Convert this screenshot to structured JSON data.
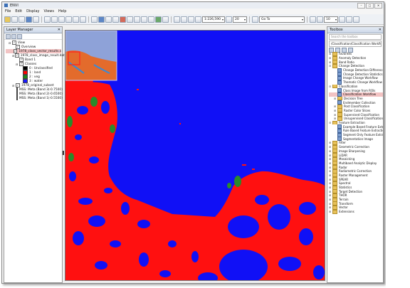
{
  "window": {
    "title": "ENVI"
  },
  "menu": [
    "File",
    "Edit",
    "Display",
    "Views",
    "Help"
  ],
  "toolbar": {
    "zoom_value": "1:226,590",
    "percent_value": "10",
    "goto_label": "Go To",
    "value2": "20"
  },
  "layer_manager": {
    "title": "Layer Manager",
    "items": [
      {
        "label": "View",
        "indent": 0
      },
      {
        "label": "Overview",
        "indent": 1
      },
      {
        "label": "1978_class_vector_results.s",
        "indent": 1,
        "highlight": "red"
      },
      {
        "label": "1978_class_image_result.dat",
        "indent": 1
      },
      {
        "label": "Band 1",
        "indent": 2
      },
      {
        "label": "Classes",
        "indent": 2
      },
      {
        "label": "0 : Unclassified",
        "indent": 3,
        "swatch": "#000000"
      },
      {
        "label": "1 : land",
        "indent": 3,
        "swatch": "#ff0000"
      },
      {
        "label": "2 : veg",
        "indent": 3,
        "swatch": "#1a8a1a"
      },
      {
        "label": "3 : water",
        "indent": 3,
        "swatch": "#1a1aff"
      },
      {
        "label": "1978_original_subset",
        "indent": 1
      },
      {
        "label": "MSS: Meta (Band 3(-0.7500)",
        "indent": 2,
        "swatch": "#ff0000"
      },
      {
        "label": "MSS: Meta (Band 2(-0.6500)",
        "indent": 2,
        "swatch": "#1a8a1a"
      },
      {
        "label": "MSS: Meta (Band 1(-0.5500)",
        "indent": 2,
        "swatch": "#1a1aff"
      }
    ]
  },
  "toolbox": {
    "title": "Toolbox",
    "search_placeholder": "Search the toolbox",
    "path": "/Classification/Classification Workflow",
    "items": [
      {
        "label": "Favorites",
        "type": "folder",
        "level": 0
      },
      {
        "label": "Anomaly Detection",
        "type": "folder",
        "level": 0
      },
      {
        "label": "Band Ratio",
        "type": "folder",
        "level": 0
      },
      {
        "label": "Change Detection",
        "type": "folder",
        "level": 0,
        "open": true
      },
      {
        "label": "Change Detection Difference Ma",
        "type": "tool",
        "level": 1
      },
      {
        "label": "Change Detection Statistics",
        "type": "tool",
        "level": 1
      },
      {
        "label": "Image Change Workflow",
        "type": "tool",
        "level": 1
      },
      {
        "label": "Thematic Change Workflow",
        "type": "tool",
        "level": 1
      },
      {
        "label": "Classification",
        "type": "folder",
        "level": 0,
        "open": true
      },
      {
        "label": "Class Image from ROIs",
        "type": "tool",
        "level": 1
      },
      {
        "label": "Classification Workflow",
        "type": "tool",
        "level": 1,
        "selected": true
      },
      {
        "label": "Decision Tree",
        "type": "folder",
        "level": 1
      },
      {
        "label": "Endmember Collection",
        "type": "tool",
        "level": 1
      },
      {
        "label": "Post Classification",
        "type": "folder",
        "level": 1
      },
      {
        "label": "Raster Color Slices",
        "type": "folder",
        "level": 1
      },
      {
        "label": "Supervised Classification",
        "type": "folder",
        "level": 1
      },
      {
        "label": "Unsupervised Classification",
        "type": "folder",
        "level": 1
      },
      {
        "label": "Feature Extraction",
        "type": "folder",
        "level": 0,
        "open": true
      },
      {
        "label": "Example Based Feature Extractio",
        "type": "tool",
        "level": 1
      },
      {
        "label": "Rule Based Feature Extraction W",
        "type": "tool",
        "level": 1
      },
      {
        "label": "Segment Only Feature Extractio",
        "type": "tool",
        "level": 1
      },
      {
        "label": "Segmentation Image",
        "type": "tool",
        "level": 1
      },
      {
        "label": "Filter",
        "type": "folder",
        "level": 0
      },
      {
        "label": "Geometric Correction",
        "type": "folder",
        "level": 0
      },
      {
        "label": "Image Sharpening",
        "type": "folder",
        "level": 0
      },
      {
        "label": "LiDAR",
        "type": "folder",
        "level": 0
      },
      {
        "label": "Mosaicking",
        "type": "folder",
        "level": 0
      },
      {
        "label": "Multiband Analytic Display",
        "type": "folder",
        "level": 0
      },
      {
        "label": "Radar",
        "type": "folder",
        "level": 0
      },
      {
        "label": "Radiometric Correction",
        "type": "folder",
        "level": 0
      },
      {
        "label": "Raster Management",
        "type": "folder",
        "level": 0
      },
      {
        "label": "SPEAR",
        "type": "folder",
        "level": 0
      },
      {
        "label": "Spectral",
        "type": "folder",
        "level": 0
      },
      {
        "label": "Statistics",
        "type": "folder",
        "level": 0
      },
      {
        "label": "Target Detection",
        "type": "folder",
        "level": 0
      },
      {
        "label": "THOR",
        "type": "folder",
        "level": 0
      },
      {
        "label": "Terrain",
        "type": "folder",
        "level": 0
      },
      {
        "label": "Transform",
        "type": "folder",
        "level": 0
      },
      {
        "label": "Vector",
        "type": "folder",
        "level": 0
      },
      {
        "label": "Extensions",
        "type": "folder",
        "level": 0
      }
    ]
  },
  "colors": {
    "land": "#ff1010",
    "water": "#1010f6",
    "veg": "#2a8a2a"
  }
}
